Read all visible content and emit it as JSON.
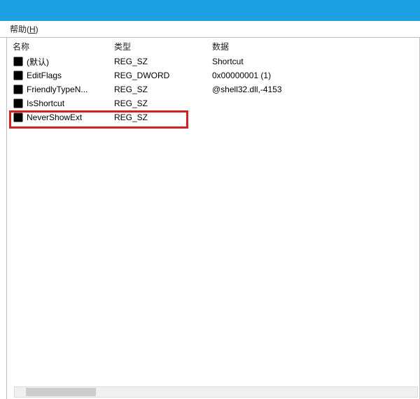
{
  "menubar": {
    "help_label": "帮助(",
    "help_hotkey": "H",
    "help_label_close": ")"
  },
  "columns": {
    "name": "名称",
    "type": "类型",
    "data": "数据"
  },
  "rows": [
    {
      "icon": "string",
      "name": "(默认)",
      "type": "REG_SZ",
      "data": "Shortcut"
    },
    {
      "icon": "binary",
      "name": "EditFlags",
      "type": "REG_DWORD",
      "data": "0x00000001 (1)"
    },
    {
      "icon": "string",
      "name": "FriendlyTypeN...",
      "type": "REG_SZ",
      "data": "@shell32.dll,-4153"
    },
    {
      "icon": "string",
      "name": "IsShortcut",
      "type": "REG_SZ",
      "data": ""
    },
    {
      "icon": "string",
      "name": "NeverShowExt",
      "type": "REG_SZ",
      "data": ""
    }
  ],
  "highlight_row_index": 3
}
